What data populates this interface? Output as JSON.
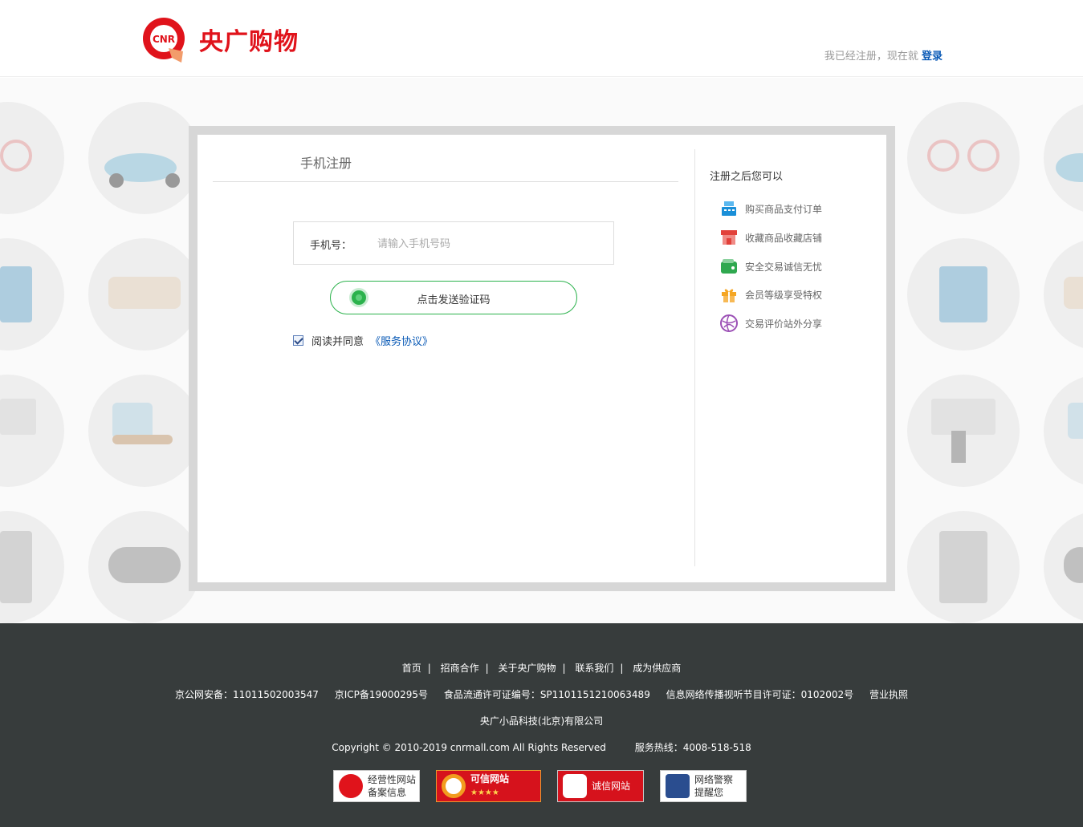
{
  "header": {
    "logo_mark_text": "CNR",
    "logo_text": "央广购物",
    "login_prompt": "我已经注册，现在就",
    "login_link": "登录"
  },
  "register": {
    "tab_title": "手机注册",
    "phone_label": "手机号：",
    "phone_placeholder": "请输入手机号码",
    "send_code_label": "点击发送验证码",
    "agree_text": "阅读并同意",
    "agree_link": "《服务协议》",
    "agree_checked": true
  },
  "sidebar": {
    "title": "注册之后您可以",
    "items": [
      {
        "label": "购买商品支付订单",
        "icon": "cash-register-icon",
        "color": "#1a8fd8"
      },
      {
        "label": "收藏商品收藏店铺",
        "icon": "store-icon",
        "color": "#e2413a"
      },
      {
        "label": "安全交易诚信无忧",
        "icon": "wallet-icon",
        "color": "#2fa84f"
      },
      {
        "label": "会员等级享受特权",
        "icon": "gift-icon",
        "color": "#f5a623"
      },
      {
        "label": "交易评价站外分享",
        "icon": "share-globe-icon",
        "color": "#9b4fb5"
      }
    ]
  },
  "footer": {
    "nav": [
      "首页",
      "招商合作",
      "关于央广购物",
      "联系我们",
      "成为供应商"
    ],
    "licenses": [
      "京公网安备：11011502003547",
      "京ICP备19000295号",
      "食品流通许可证编号：SP1101151210063489",
      "信息网络传播视听节目许可证：0102002号",
      "营业执照"
    ],
    "company": "央广小品科技(北京)有限公司",
    "copyright": "Copyright © 2010-2019  cnrmall.com  All  Rights  Reserved",
    "hotline": "服务热线：4008-518-518",
    "badges": [
      {
        "line1": "经营性网站",
        "line2": "备案信息"
      },
      {
        "line1": "可信网站",
        "line2": "★★★★"
      },
      {
        "line1": "诚信网站",
        "line2": ""
      },
      {
        "line1": "网络警察",
        "line2": "提醒您"
      }
    ]
  },
  "colors": {
    "brand_red": "#e0131b",
    "link_blue": "#0a5ab6",
    "accent_green": "#2bb24c",
    "footer_bg": "#373c3c"
  }
}
